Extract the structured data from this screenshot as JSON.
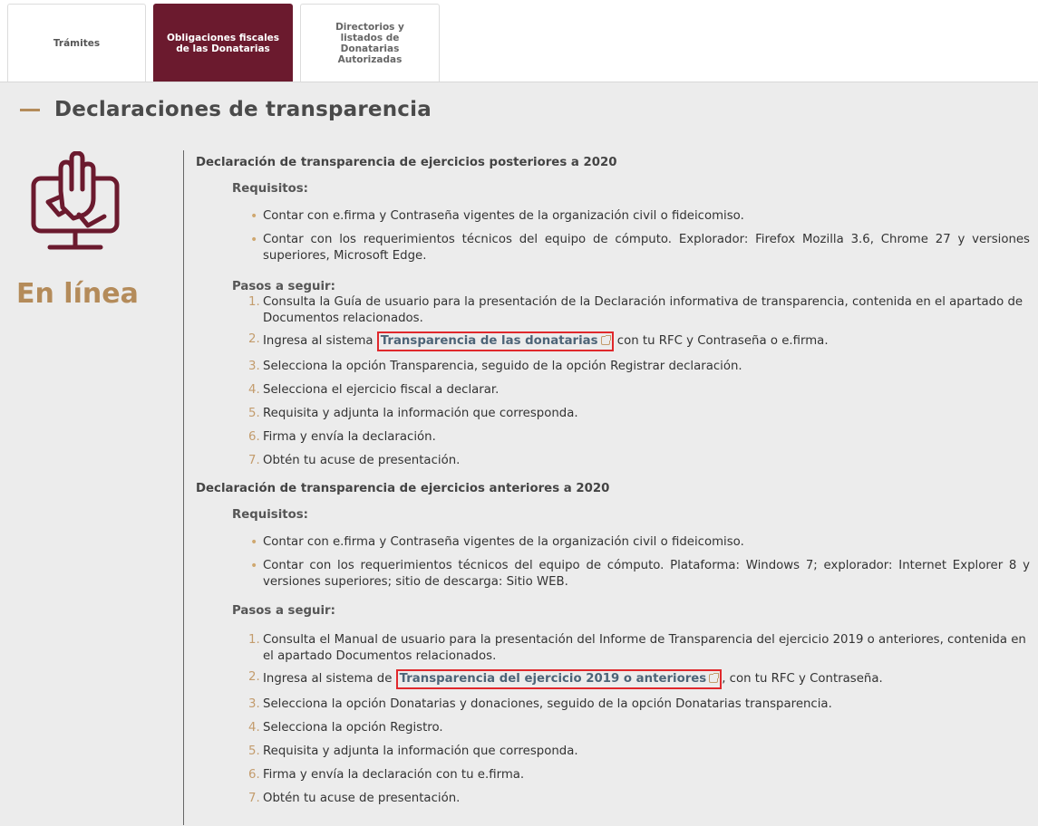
{
  "tabs": [
    {
      "label": "Trámites"
    },
    {
      "label": "Obligaciones fiscales de las Donatarias"
    },
    {
      "label": "Directorios y listados de Donatarias Autorizadas"
    }
  ],
  "section_title": "Declaraciones de transparencia",
  "online_label": "En línea",
  "posteriores": {
    "heading": "Declaración de transparencia de ejercicios posteriores a 2020",
    "requisitos_label": "Requisitos:",
    "requisitos": [
      "Contar con e.firma y Contraseña vigentes de la organización civil o fideicomiso.",
      "Contar con los requerimientos técnicos del equipo de cómputo. Explorador: Firefox Mozilla 3.6, Chrome 27 y versiones superiores, Microsoft Edge."
    ],
    "pasos_label": "Pasos a seguir:",
    "pasos": [
      {
        "num": "1.",
        "text": "Consulta la Guía de usuario para la presentación de la Declaración informativa de transparencia, contenida en el apartado de Documentos relacionados."
      },
      {
        "num": "2.",
        "before": "Ingresa al sistema ",
        "link": "Transparencia de las donatarias",
        "after": " con tu RFC y Contraseña o e.firma."
      },
      {
        "num": "3.",
        "text": "Selecciona la opción Transparencia, seguido de la opción Registrar declaración."
      },
      {
        "num": "4.",
        "text": "Selecciona el ejercicio fiscal a declarar."
      },
      {
        "num": "5.",
        "text": "Requisita y adjunta la información que corresponda."
      },
      {
        "num": "6.",
        "text": "Firma y envía la declaración."
      },
      {
        "num": "7.",
        "text": "Obtén tu acuse de presentación."
      }
    ]
  },
  "anteriores": {
    "heading": "Declaración de transparencia de ejercicios anteriores a 2020",
    "requisitos_label": "Requisitos:",
    "requisitos": [
      "Contar con e.firma y Contraseña vigentes de la organización civil o fideicomiso.",
      "Contar con los requerimientos técnicos del equipo de cómputo. Plataforma: Windows 7; explorador: Internet Explorer 8 y versiones superiores; sitio de descarga: Sitio WEB."
    ],
    "pasos_label": "Pasos a seguir:",
    "pasos": [
      {
        "num": "1.",
        "text": "Consulta el Manual de usuario para la presentación del Informe de Transparencia del ejercicio 2019 o anteriores, contenida en el apartado Documentos relacionados."
      },
      {
        "num": "2.",
        "before": "Ingresa al sistema de ",
        "link": "Transparencia del ejercicio 2019 o anteriores",
        "after": ", con tu RFC y Contraseña."
      },
      {
        "num": "3.",
        "text": "Selecciona la opción Donatarias y donaciones, seguido de la opción Donatarias transparencia."
      },
      {
        "num": "4.",
        "text": "Selecciona la opción Registro."
      },
      {
        "num": "5.",
        "text": "Requisita y adjunta la información que corresponda."
      },
      {
        "num": "6.",
        "text": "Firma y envía la declaración con tu e.firma."
      },
      {
        "num": "7.",
        "text": "Obtén tu acuse de presentación."
      }
    ]
  },
  "colors": {
    "brand": "#6b1a2e",
    "accent": "#b48b5a",
    "highlight": "#e0282c"
  }
}
